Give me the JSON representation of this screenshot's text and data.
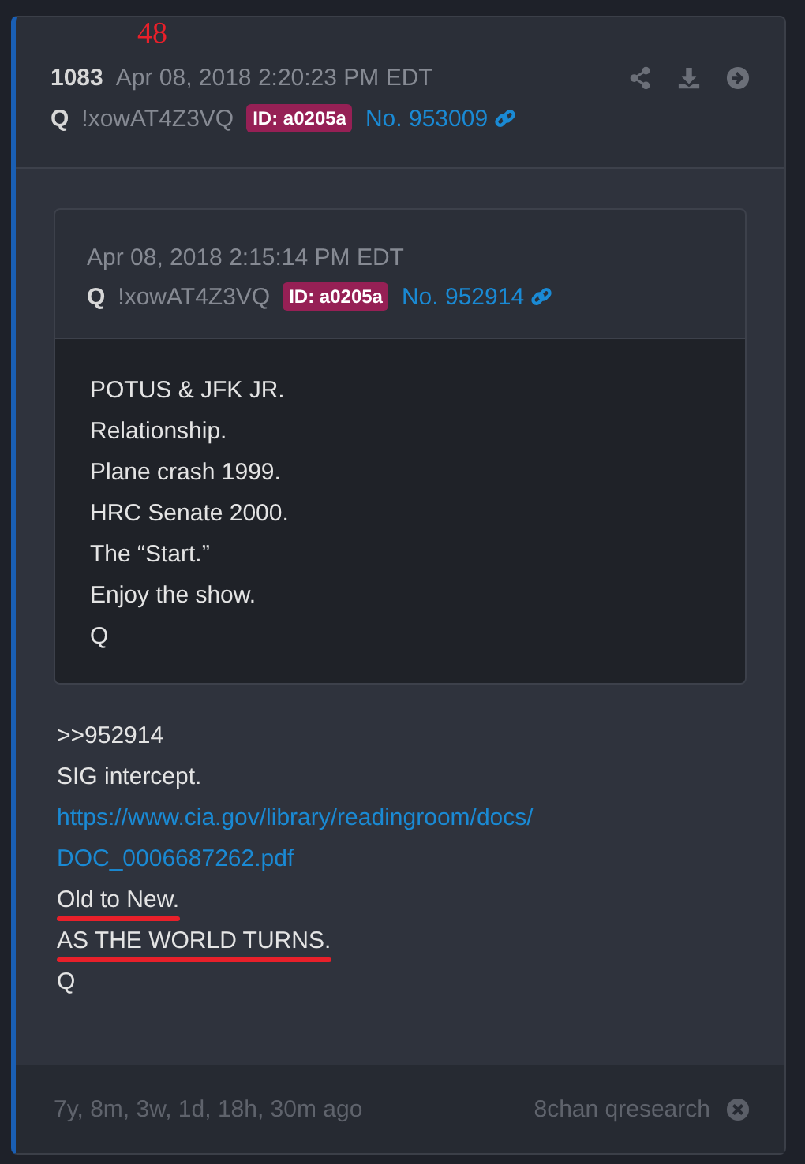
{
  "annotation": "48",
  "post": {
    "number": "1083",
    "timestamp": "Apr 08, 2018 2:20:23 PM EDT",
    "author": "Q",
    "tripcode": "!xowAT4Z3VQ",
    "id_badge": "ID: a0205a",
    "post_no": "No. 953009"
  },
  "quote": {
    "timestamp": "Apr 08, 2018 2:15:14 PM EDT",
    "author": "Q",
    "tripcode": "!xowAT4Z3VQ",
    "id_badge": "ID: a0205a",
    "post_no": "No. 952914",
    "lines": [
      "POTUS & JFK JR.",
      "Relationship.",
      "Plane crash 1999.",
      "HRC Senate 2000.",
      "The “Start.”",
      "Enjoy the show.",
      "Q"
    ]
  },
  "body": [
    {
      "kind": "text",
      "text": ">>952914",
      "annotated": false
    },
    {
      "kind": "text",
      "text": "SIG intercept.",
      "annotated": false
    },
    {
      "kind": "link",
      "text": "https://www.cia.gov/library/readingroom/docs/"
    },
    {
      "kind": "link",
      "text": "DOC_0006687262.pdf"
    },
    {
      "kind": "text",
      "text": "Old to New.",
      "annotated": true
    },
    {
      "kind": "text",
      "text": "AS THE WORLD TURNS.",
      "annotated": true
    },
    {
      "kind": "text",
      "text": "Q",
      "annotated": false
    }
  ],
  "footer": {
    "age": "7y, 8m, 3w, 1d, 18h, 30m ago",
    "source": "8chan qresearch"
  }
}
